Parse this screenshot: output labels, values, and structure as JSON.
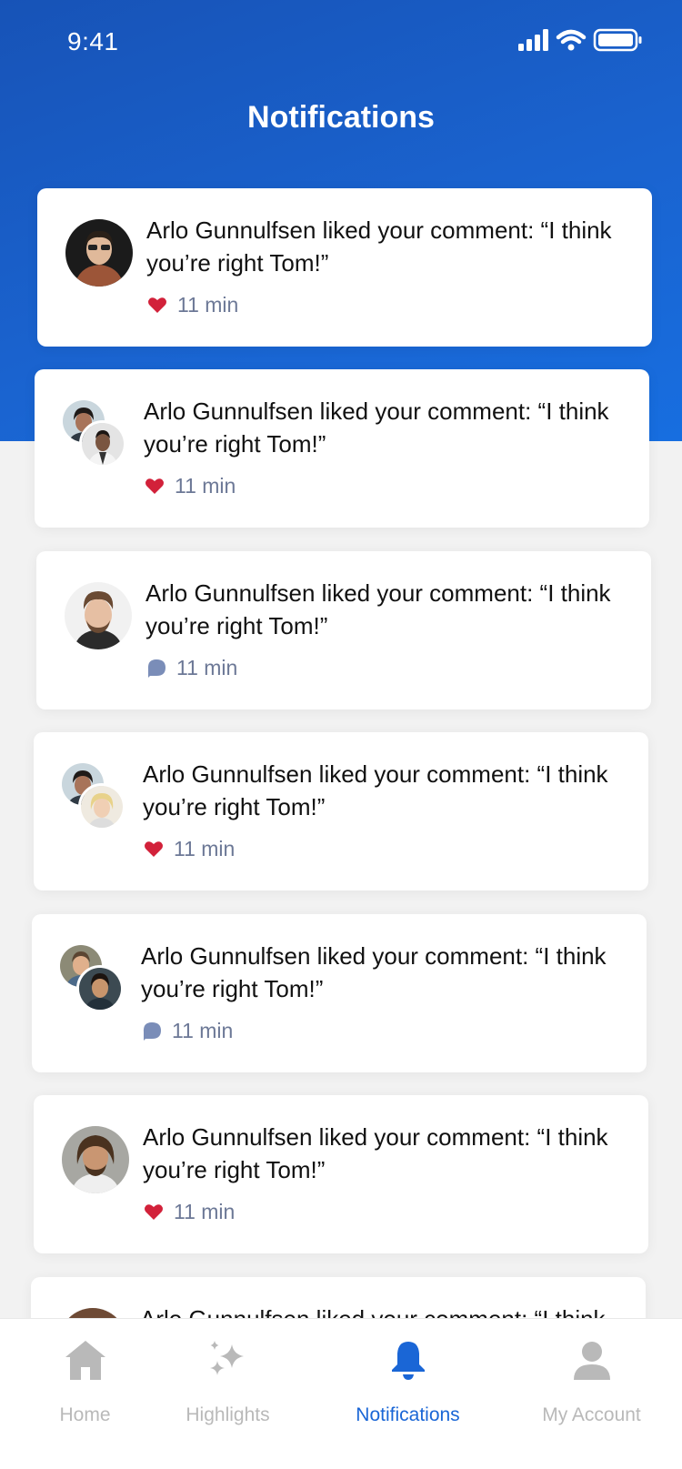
{
  "status_bar": {
    "time": "9:41"
  },
  "header": {
    "title": "Notifications"
  },
  "colors": {
    "accent": "#1a66d6",
    "header_gradient_start": "#1753b7",
    "header_gradient_end": "#176ee0",
    "like_red": "#d2213a",
    "comment_blue": "#7a8db8",
    "tab_inactive": "#b9b9b9"
  },
  "notifications": [
    {
      "text": "Arlo Gunnulfsen liked your comment: “I think you’re right Tom!”",
      "time": "11 min",
      "kind": "heart-icon"
    },
    {
      "text": "Arlo Gunnulfsen liked your comment: “I think you’re right Tom!”",
      "time": "11 min",
      "kind": "heart-icon"
    },
    {
      "text": "Arlo Gunnulfsen liked your comment: “I think you’re right Tom!”",
      "time": "11 min",
      "kind": "comment-icon"
    },
    {
      "text": "Arlo Gunnulfsen liked your comment: “I think you’re right Tom!”",
      "time": "11 min",
      "kind": "heart-icon"
    },
    {
      "text": "Arlo Gunnulfsen liked your comment: “I think you’re right Tom!”",
      "time": "11 min",
      "kind": "comment-icon"
    },
    {
      "text": "Arlo Gunnulfsen liked your comment: “I think you’re right Tom!”",
      "time": "11 min",
      "kind": "heart-icon"
    },
    {
      "text": "Arlo Gunnulfsen liked your comment: “I think",
      "time": "",
      "kind": ""
    }
  ],
  "tab_bar": {
    "tabs": [
      {
        "label": "Home",
        "icon": "home-icon",
        "active": false
      },
      {
        "label": "Highlights",
        "icon": "sparkle-icon",
        "active": false
      },
      {
        "label": "Notifications",
        "icon": "bell-icon",
        "active": true
      },
      {
        "label": "My Account",
        "icon": "user-icon",
        "active": false
      }
    ]
  }
}
